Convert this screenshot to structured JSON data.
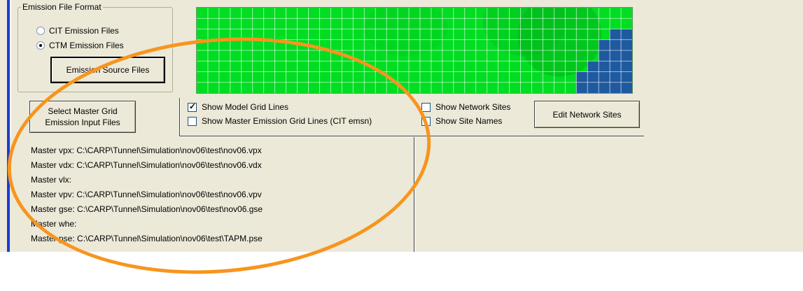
{
  "emission_format": {
    "title": "Emission File Format",
    "options": [
      "CIT Emission Files",
      "CTM Emission Files"
    ],
    "selected": "CTM Emission Files",
    "source_button": "Emission Source Files"
  },
  "select_master_button": {
    "line1": "Select Master Grid",
    "line2": "Emission Input Files"
  },
  "checkboxes": {
    "show_model_grid_lines": {
      "label": "Show Model Grid Lines",
      "checked": true
    },
    "show_master_emission_grid_lines": {
      "label": "Show Master Emission Grid Lines (CIT emsn)",
      "checked": false
    },
    "show_network_sites": {
      "label": "Show Network Sites",
      "checked": false
    },
    "show_site_names": {
      "label": "Show Site Names",
      "checked": false
    }
  },
  "edit_network_sites_button": "Edit Network Sites",
  "master_files": [
    "Master vpx: C:\\CARP\\Tunnel\\Simulation\\nov06\\test\\nov06.vpx",
    "Master vdx: C:\\CARP\\Tunnel\\Simulation\\nov06\\test\\nov06.vdx",
    "Master vlx:",
    "Master vpv: C:\\CARP\\Tunnel\\Simulation\\nov06\\test\\nov06.vpv",
    "Master gse: C:\\CARP\\Tunnel\\Simulation\\nov06\\test\\nov06.gse",
    "Master whe:",
    "Master pse: C:\\CARP\\Tunnel\\Simulation\\nov06\\test\\TAPM.pse"
  ],
  "colors": {
    "panel": "#ece9d8",
    "grid_green": "#00dd22",
    "grid_water": "#1f5aa0",
    "highlight": "#f7951d"
  }
}
